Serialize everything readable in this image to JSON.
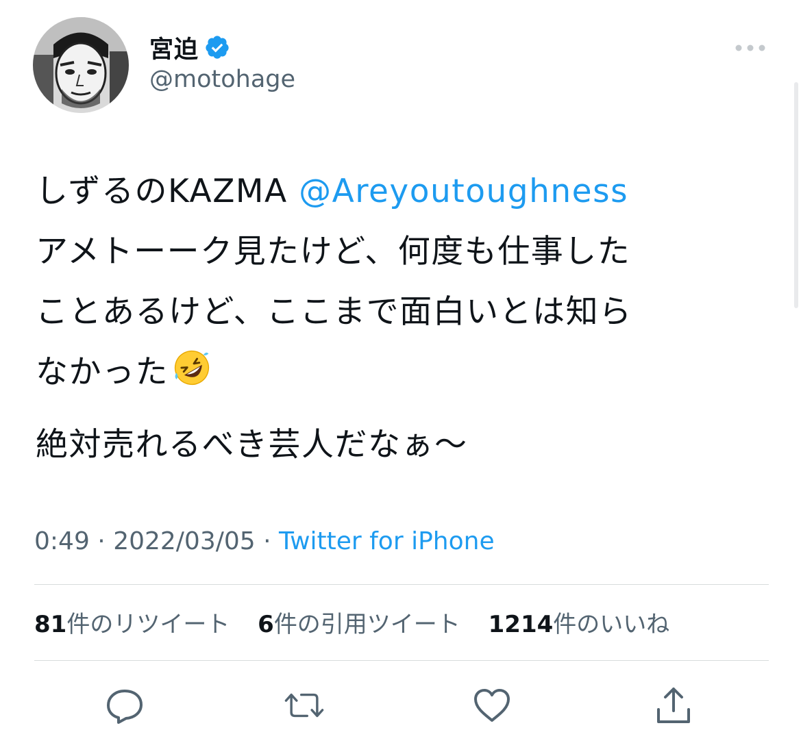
{
  "author": {
    "display_name": "宮迫",
    "handle": "@motohage",
    "verified": true
  },
  "tweet": {
    "line1_text": "しずるのKAZMA ",
    "line1_mention": "@Areyoutoughness",
    "line2": "アメトーーク見たけど、何度も仕事した",
    "line3": "ことあるけど、ここまで面白いとは知ら",
    "line4_text": "なかった",
    "line4_emoji": "rolling-on-the-floor-laughing-emoji",
    "line5": "絶対売れるべき芸人だなぁ〜"
  },
  "meta": {
    "time": "0:49",
    "separator": " · ",
    "date": "2022/03/05",
    "source": "Twitter for iPhone"
  },
  "stats": {
    "retweets_count": "81",
    "retweets_label": "件のリツイート",
    "quotes_count": "6",
    "quotes_label": "件の引用ツイート",
    "likes_count": "1214",
    "likes_label": "件のいいね"
  },
  "actions": {
    "reply_icon": "reply-icon",
    "retweet_icon": "retweet-icon",
    "like_icon": "like-icon",
    "share_icon": "share-icon"
  },
  "colors": {
    "accent": "#1d9bf0",
    "text": "#0f1419",
    "secondary": "#536471",
    "divider": "#d7dbdc"
  }
}
